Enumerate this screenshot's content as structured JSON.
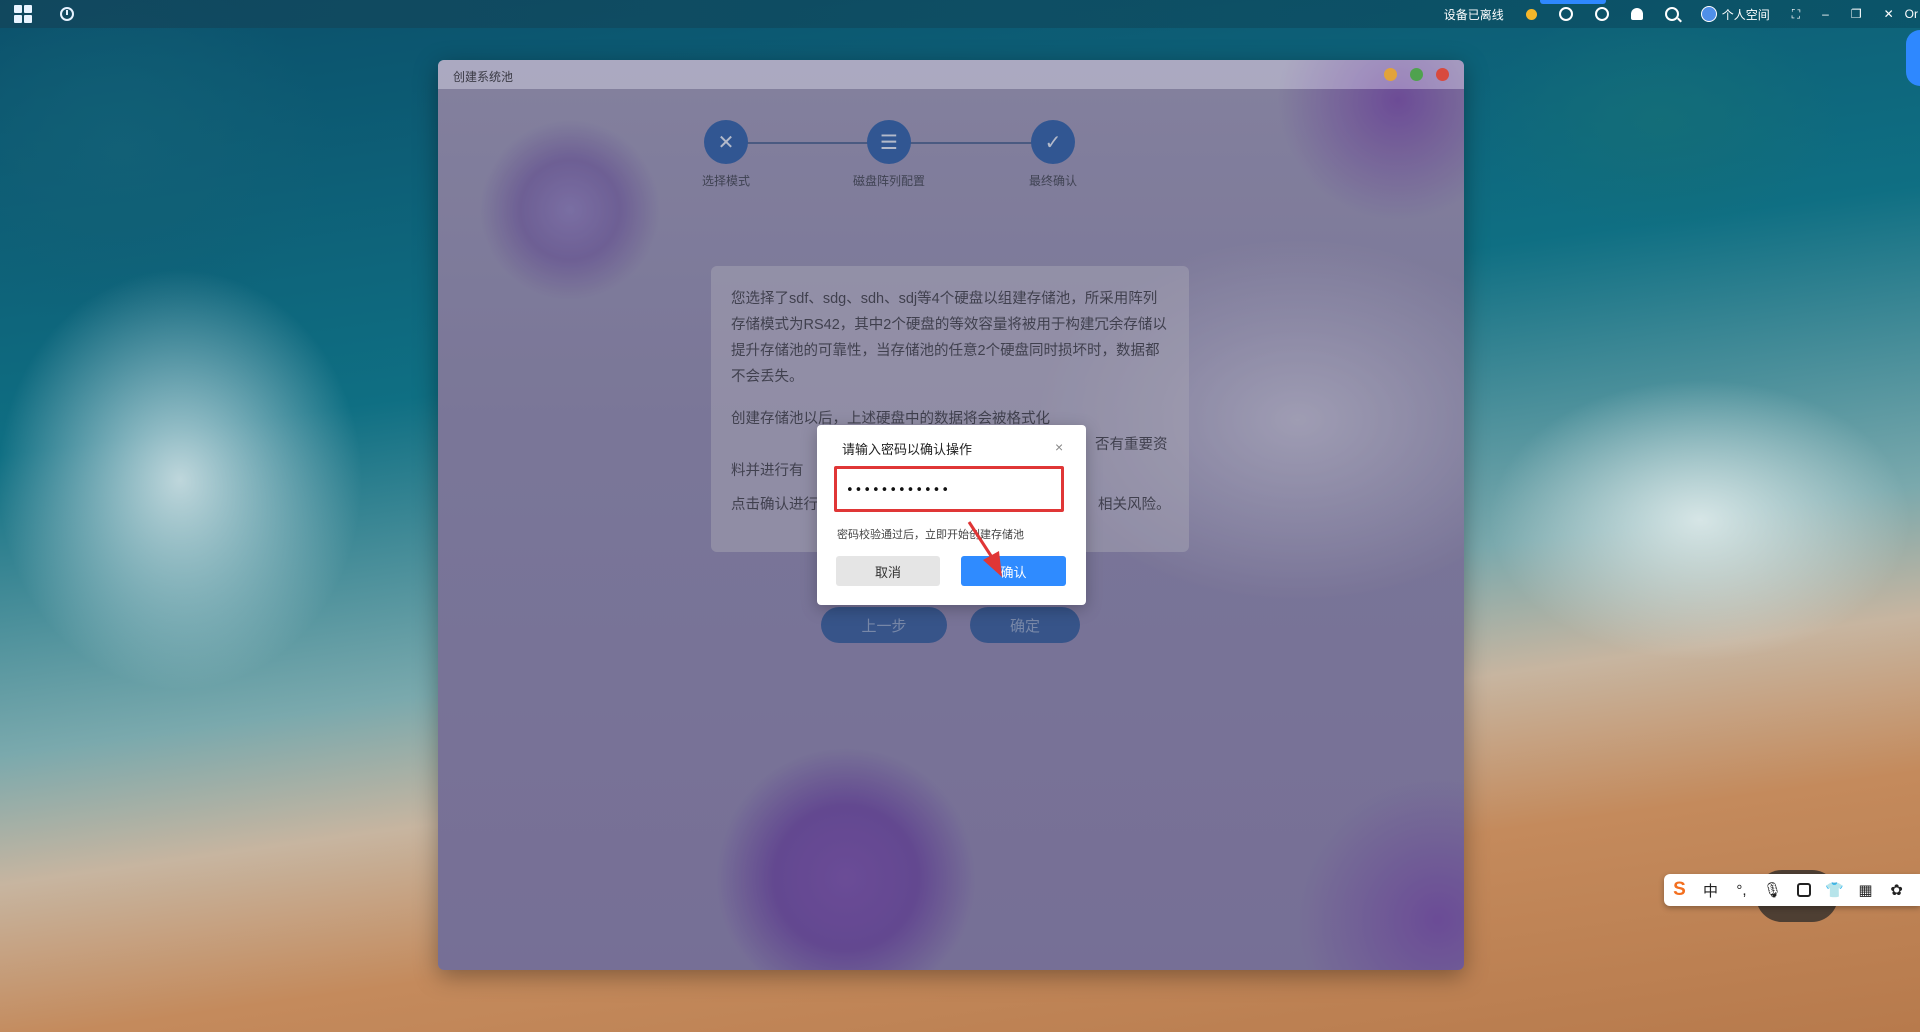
{
  "taskbar": {
    "status_text": "设备已离线",
    "user_label": "个人空间",
    "edge_text": "Or",
    "icons": [
      "windows-logo-icon",
      "clock-icon",
      "status-dot-icon",
      "timer-icon",
      "sync-icon",
      "bell-icon",
      "search-icon",
      "user-icon",
      "fullscreen-icon",
      "minimize-icon",
      "restore-icon",
      "close-icon"
    ]
  },
  "window": {
    "title": "创建系统池",
    "controls": [
      "minimize",
      "maximize",
      "close"
    ],
    "control_colors": {
      "minimize": "#e2a33a",
      "maximize": "#4fa24e",
      "close": "#d84a3e"
    }
  },
  "steps": [
    {
      "label": "选择模式",
      "icon": "tools-icon"
    },
    {
      "label": "磁盘阵列配置",
      "icon": "database-icon"
    },
    {
      "label": "最终确认",
      "icon": "check-icon"
    }
  ],
  "info": {
    "para1": "您选择了sdf、sdg、sdh、sdj等4个硬盘以组建存储池，所采用阵列存储模式为RS42，其中2个硬盘的等效容量将被用于构建冗余存储以提升存储池的可靠性，当存储池的任意2个硬盘同时损坏时，数据都不会丢失。",
    "para2": "创建存储池以后，上述硬盘中的数据将会被格式化，因此产生的数据丢失",
    "para2_right": "否有重要资",
    "para2_line3": "料并进行有",
    "para3_left": "点击确认进行",
    "para3_right": "相关风险。"
  },
  "bottom_buttons": {
    "prev": "上一步",
    "confirm": "确定"
  },
  "dialog": {
    "title": "请输入密码以确认操作",
    "close_glyph": "×",
    "password_value": "••••••••••••",
    "hint": "密码校验通过后，立即开始创建存储池",
    "cancel_label": "取消",
    "ok_label": "确认",
    "highlight_color": "#e03636",
    "ok_color": "#2f8bff"
  },
  "ime": {
    "logo": "S",
    "mode": "中",
    "punct": "°,"
  }
}
